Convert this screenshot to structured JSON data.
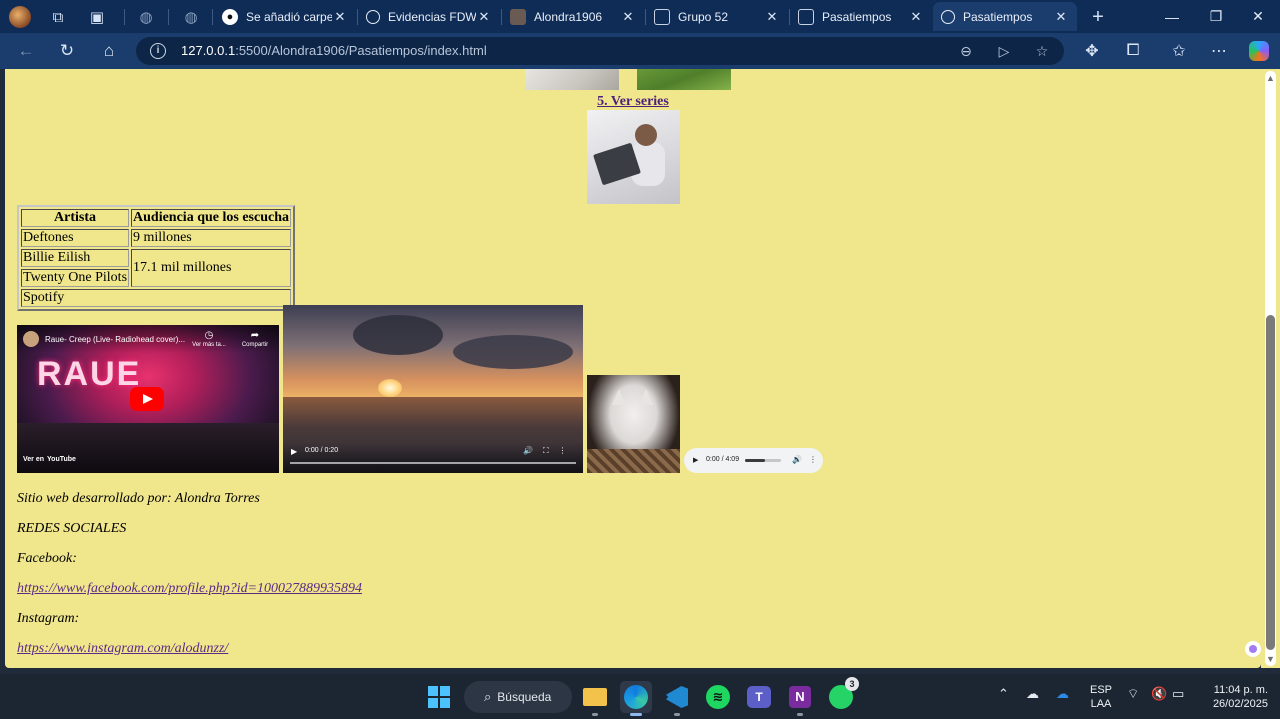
{
  "browser": {
    "tabs": [
      {
        "title": "Se añadió carpeta",
        "icon": "github-icon"
      },
      {
        "title": "Evidencias FDW",
        "icon": "globe-icon"
      },
      {
        "title": "Alondra1906",
        "icon": "avatar-icon"
      },
      {
        "title": "Grupo 52",
        "icon": "page-icon"
      },
      {
        "title": "Pasatiempos",
        "icon": "page-icon"
      },
      {
        "title": "Pasatiempos",
        "icon": "globe-icon",
        "active": true
      }
    ],
    "url_host": "127.0.0.1",
    "url_path": ":5500/Alondra1906/Pasatiempos/index.html",
    "new_tab_label": "+"
  },
  "page": {
    "series_link": "5. Ver series",
    "table": {
      "headers": [
        "Artista",
        "Audiencia que los escucha"
      ],
      "rows": [
        {
          "artist": "Deftones",
          "audience": "9 millones"
        },
        {
          "artist": "Billie Eilish",
          "audience": "17.1 mil millones"
        },
        {
          "artist": "Twenty One Pilots"
        }
      ],
      "footer": "Spotify"
    },
    "youtube": {
      "title": "Raue- Creep (Live- Radiohead cover)...",
      "watch_later": "Ver más ta...",
      "share": "Compartir",
      "banner": "RAUE",
      "watch_on": "Ver en",
      "brand": "YouTube"
    },
    "video": {
      "time": "0:00 / 0:20"
    },
    "audio": {
      "time": "0:00 / 4:09"
    },
    "footer": {
      "credit": "Sitio web desarrollado por: Alondra Torres",
      "social_title": "REDES SOCIALES",
      "facebook_label": "Facebook:",
      "facebook_url": "https://www.facebook.com/profile.php?id=100027889935894",
      "instagram_label": "Instagram:",
      "instagram_url": "https://www.instagram.com/alodunzz/"
    }
  },
  "taskbar": {
    "search": "Búsqueda",
    "whatsapp_badge": "3",
    "lang_top": "ESP",
    "lang_bottom": "LAA",
    "time": "11:04 p. m.",
    "date": "26/02/2025"
  },
  "colors": {
    "page_background": "#f0e68c",
    "link_visited": "#5a2c85",
    "tab_strip": "#0f2c56"
  }
}
